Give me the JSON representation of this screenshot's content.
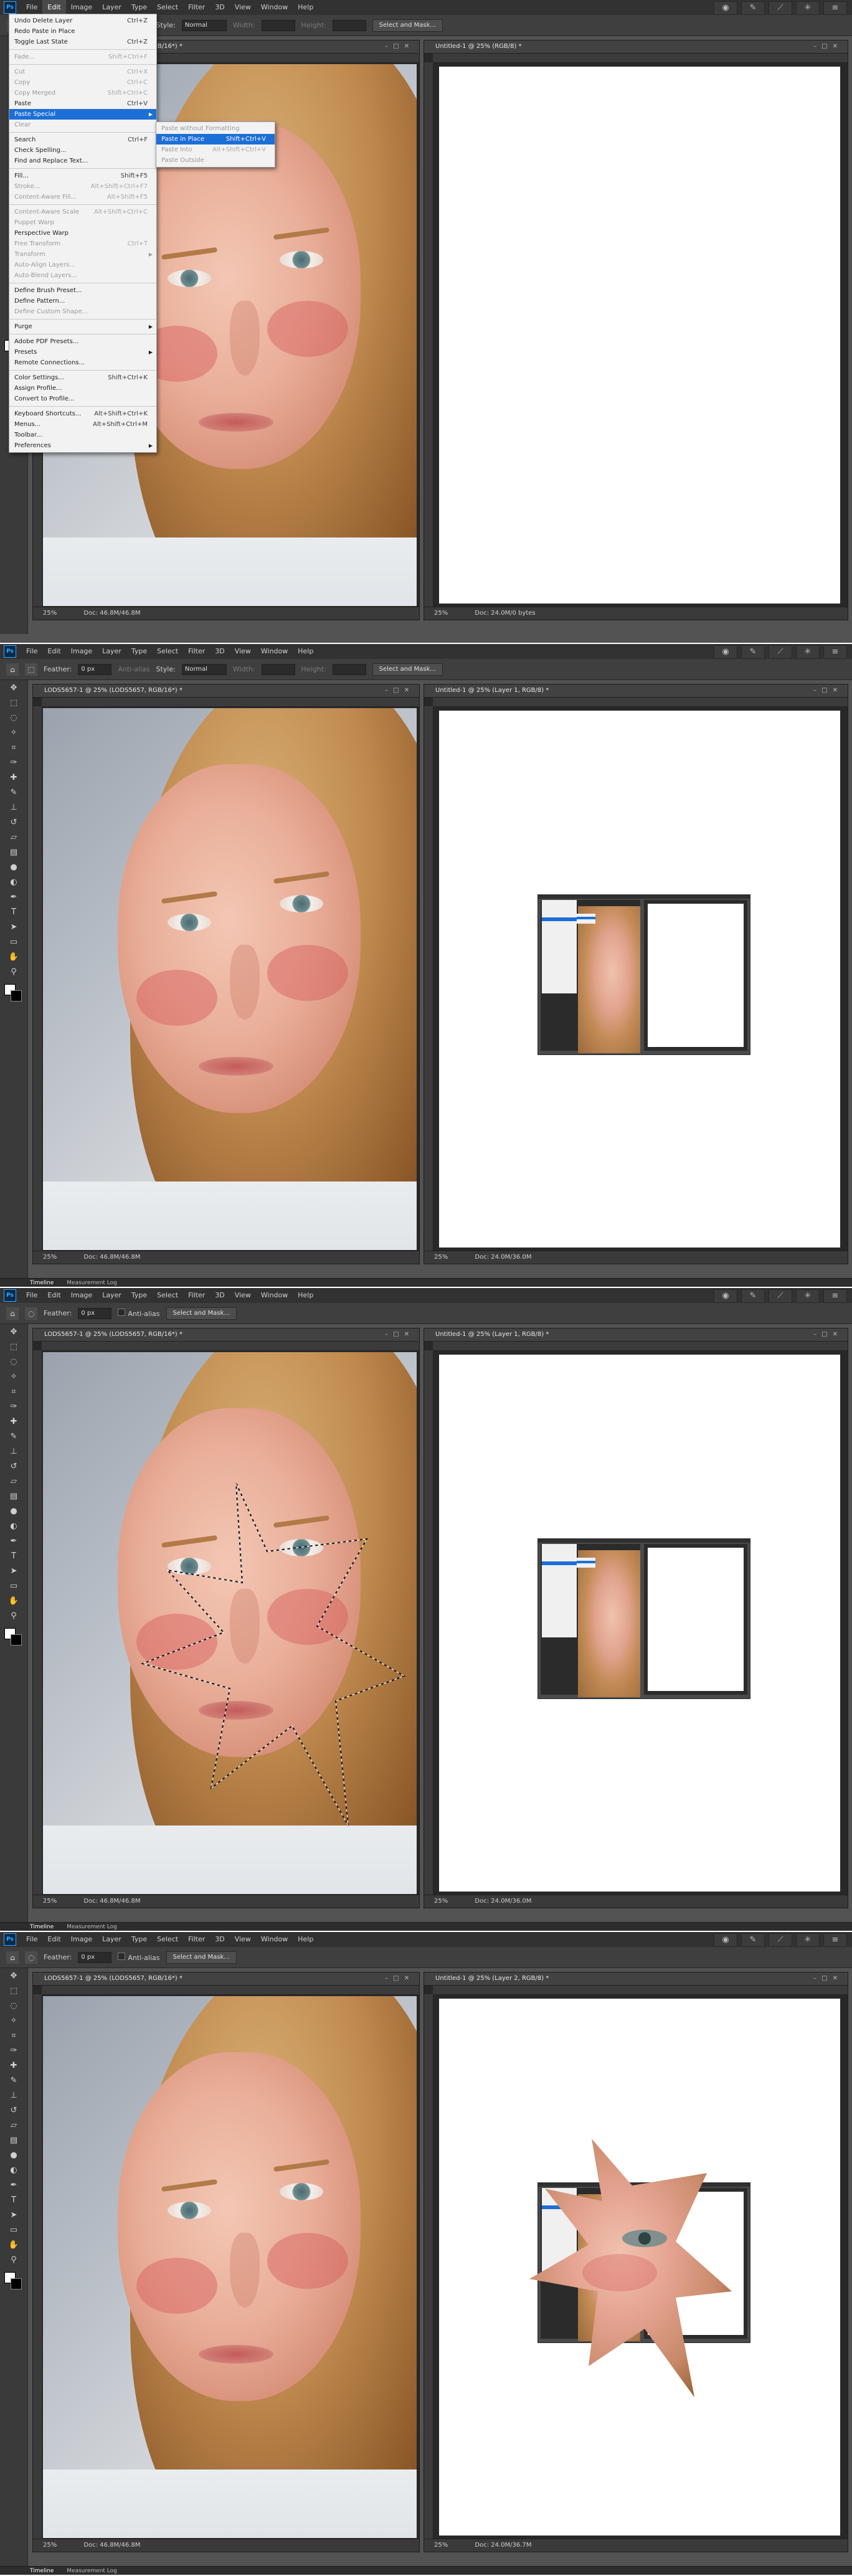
{
  "app": {
    "logo": "Ps",
    "menu": [
      "File",
      "Edit",
      "Image",
      "Layer",
      "Type",
      "Select",
      "Filter",
      "3D",
      "View",
      "Window",
      "Help"
    ]
  },
  "options_bar": {
    "feather_label": "Feather:",
    "feather_value": "0 px",
    "antialias_label": "Anti-alias",
    "style_label": "Style:",
    "style_value": "Normal",
    "width_label": "Width:",
    "height_label": "Height:",
    "select_mask_button": "Select and Mask..."
  },
  "edit_menu": [
    {
      "label": "Undo Delete Layer",
      "shortcut": "Ctrl+Z",
      "enabled": true
    },
    {
      "label": "Redo Paste in Place",
      "shortcut": "",
      "enabled": true
    },
    {
      "label": "Toggle Last State",
      "shortcut": "Ctrl+Z",
      "enabled": true
    },
    {
      "sep": true
    },
    {
      "label": "Fade...",
      "shortcut": "Shift+Ctrl+F",
      "enabled": false
    },
    {
      "sep": true
    },
    {
      "label": "Cut",
      "shortcut": "Ctrl+X",
      "enabled": false
    },
    {
      "label": "Copy",
      "shortcut": "Ctrl+C",
      "enabled": false
    },
    {
      "label": "Copy Merged",
      "shortcut": "Shift+Ctrl+C",
      "enabled": false
    },
    {
      "label": "Paste",
      "shortcut": "Ctrl+V",
      "enabled": true
    },
    {
      "label": "Paste Special",
      "shortcut": "",
      "enabled": true,
      "highlight": true,
      "submenu": true
    },
    {
      "label": "Clear",
      "shortcut": "",
      "enabled": false
    },
    {
      "sep": true
    },
    {
      "label": "Search",
      "shortcut": "Ctrl+F",
      "enabled": true
    },
    {
      "label": "Check Spelling...",
      "shortcut": "",
      "enabled": true
    },
    {
      "label": "Find and Replace Text...",
      "shortcut": "",
      "enabled": true
    },
    {
      "sep": true
    },
    {
      "label": "Fill...",
      "shortcut": "Shift+F5",
      "enabled": true
    },
    {
      "label": "Stroke...",
      "shortcut": "Alt+Shift+Ctrl+F7",
      "enabled": false
    },
    {
      "label": "Content-Aware Fill...",
      "shortcut": "Alt+Shift+F5",
      "enabled": false
    },
    {
      "sep": true
    },
    {
      "label": "Content-Aware Scale",
      "shortcut": "Alt+Shift+Ctrl+C",
      "enabled": false
    },
    {
      "label": "Puppet Warp",
      "shortcut": "",
      "enabled": false
    },
    {
      "label": "Perspective Warp",
      "shortcut": "",
      "enabled": true
    },
    {
      "label": "Free Transform",
      "shortcut": "Ctrl+T",
      "enabled": false
    },
    {
      "label": "Transform",
      "shortcut": "",
      "enabled": false,
      "submenu": true
    },
    {
      "label": "Auto-Align Layers...",
      "shortcut": "",
      "enabled": false
    },
    {
      "label": "Auto-Blend Layers...",
      "shortcut": "",
      "enabled": false
    },
    {
      "sep": true
    },
    {
      "label": "Define Brush Preset...",
      "shortcut": "",
      "enabled": true
    },
    {
      "label": "Define Pattern...",
      "shortcut": "",
      "enabled": true
    },
    {
      "label": "Define Custom Shape...",
      "shortcut": "",
      "enabled": false
    },
    {
      "sep": true
    },
    {
      "label": "Purge",
      "shortcut": "",
      "enabled": true,
      "submenu": true
    },
    {
      "sep": true
    },
    {
      "label": "Adobe PDF Presets...",
      "shortcut": "",
      "enabled": true
    },
    {
      "label": "Presets",
      "shortcut": "",
      "enabled": true,
      "submenu": true
    },
    {
      "label": "Remote Connections...",
      "shortcut": "",
      "enabled": true
    },
    {
      "sep": true
    },
    {
      "label": "Color Settings...",
      "shortcut": "Shift+Ctrl+K",
      "enabled": true
    },
    {
      "label": "Assign Profile...",
      "shortcut": "",
      "enabled": true
    },
    {
      "label": "Convert to Profile...",
      "shortcut": "",
      "enabled": true
    },
    {
      "sep": true
    },
    {
      "label": "Keyboard Shortcuts...",
      "shortcut": "Alt+Shift+Ctrl+K",
      "enabled": true
    },
    {
      "label": "Menus...",
      "shortcut": "Alt+Shift+Ctrl+M",
      "enabled": true
    },
    {
      "label": "Toolbar...",
      "shortcut": "",
      "enabled": true
    },
    {
      "label": "Preferences",
      "shortcut": "",
      "enabled": true,
      "submenu": true
    }
  ],
  "paste_special_menu": [
    {
      "label": "Paste without Formatting",
      "shortcut": "",
      "enabled": false
    },
    {
      "label": "Paste in Place",
      "shortcut": "Shift+Ctrl+V",
      "enabled": true,
      "highlight": true
    },
    {
      "label": "Paste Into",
      "shortcut": "Alt+Shift+Ctrl+V",
      "enabled": false
    },
    {
      "label": "Paste Outside",
      "shortcut": "",
      "enabled": false
    }
  ],
  "docs": {
    "source_title": "LODS5657-1 @ 25% (LODS5657, RGB/16*) *",
    "untitled_1": "Untitled-1 @ 25% (RGB/8) *",
    "untitled_layer1": "Untitled-1 @ 25% (Layer 1, RGB/8) *",
    "untitled_layer2": "Untitled-1 @ 25% (Layer 2, RGB/8) *",
    "zoom": "25%",
    "source_doc_size": "Doc: 46.8M/46.8M",
    "untitled_doc_size_a": "Doc: 24.0M/0 bytes",
    "untitled_doc_size_b": "Doc: 24.0M/36.0M",
    "untitled_doc_size_c": "Doc: 24.0M/36.7M"
  },
  "bottom_tabs": {
    "timeline": "Timeline",
    "measurement": "Measurement Log"
  },
  "colors": {
    "menu_highlight": "#1c6fd6",
    "ui_dark": "#323232",
    "canvas_bg": "#282828"
  }
}
